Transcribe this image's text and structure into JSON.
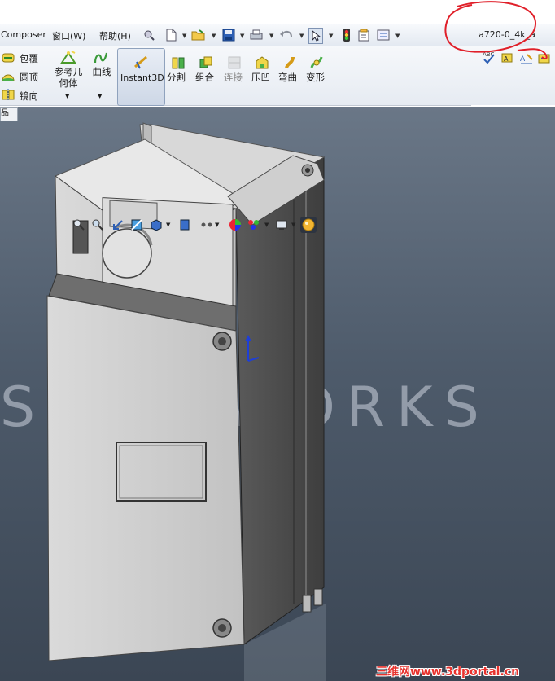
{
  "menubar": {
    "composer": "Composer",
    "window_menu": "窗口(W)",
    "help_menu": "帮助(H)"
  },
  "document": {
    "title": "a720-0_4k_a"
  },
  "ribbon": {
    "wrap": "包覆",
    "dome": "圆顶",
    "mirror": "镜向",
    "ref_geometry_line1": "参考几",
    "ref_geometry_line2": "何体",
    "curves": "曲线",
    "instant3d": "Instant3D",
    "split": "分割",
    "combine": "组合",
    "connect": "连接",
    "indent": "压凹",
    "flex": "弯曲",
    "deform": "变形"
  },
  "feature_tree_tab": "品",
  "viewport": {
    "watermark": "SOLIDWORKS"
  },
  "footer_watermark": "三维网www.3dportal.cn",
  "colors": {
    "annotation_circle": "#e0202a",
    "viewport_top": "#6a7787",
    "viewport_bottom": "#3b4654",
    "axis_triad": "#1f3fd6"
  }
}
